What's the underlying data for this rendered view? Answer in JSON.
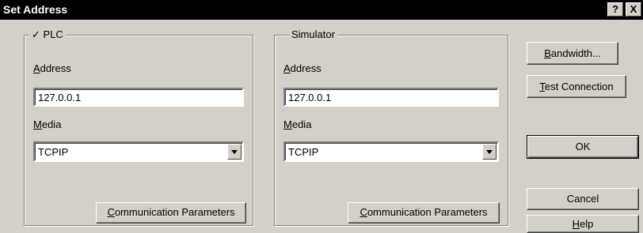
{
  "window": {
    "title": "Set Address",
    "help_btn": "?",
    "close_btn": "X"
  },
  "plc": {
    "legend_check": "✓",
    "legend": "PLC",
    "address_label": {
      "acc": "A",
      "rest": "ddress"
    },
    "address_value": "127.0.0.1",
    "media_label": {
      "acc": "M",
      "rest": "edia"
    },
    "media_value": "TCPIP",
    "comm_button": {
      "acc": "C",
      "rest": "ommunication Parameters"
    }
  },
  "simulator": {
    "legend": "Simulator",
    "address_label": {
      "acc": "A",
      "rest": "ddress"
    },
    "address_value": "127.0.0.1",
    "media_label": {
      "acc": "M",
      "rest": "edia"
    },
    "media_value": "TCPIP",
    "comm_button": {
      "acc": "C",
      "rest": "ommunication Parameters"
    }
  },
  "buttons": {
    "bandwidth": {
      "acc": "B",
      "rest": "andwidth..."
    },
    "test_connection": {
      "acc": "T",
      "rest": "est Connection"
    },
    "ok": "OK",
    "cancel": "Cancel",
    "help": {
      "acc": "H",
      "rest": "elp"
    }
  }
}
